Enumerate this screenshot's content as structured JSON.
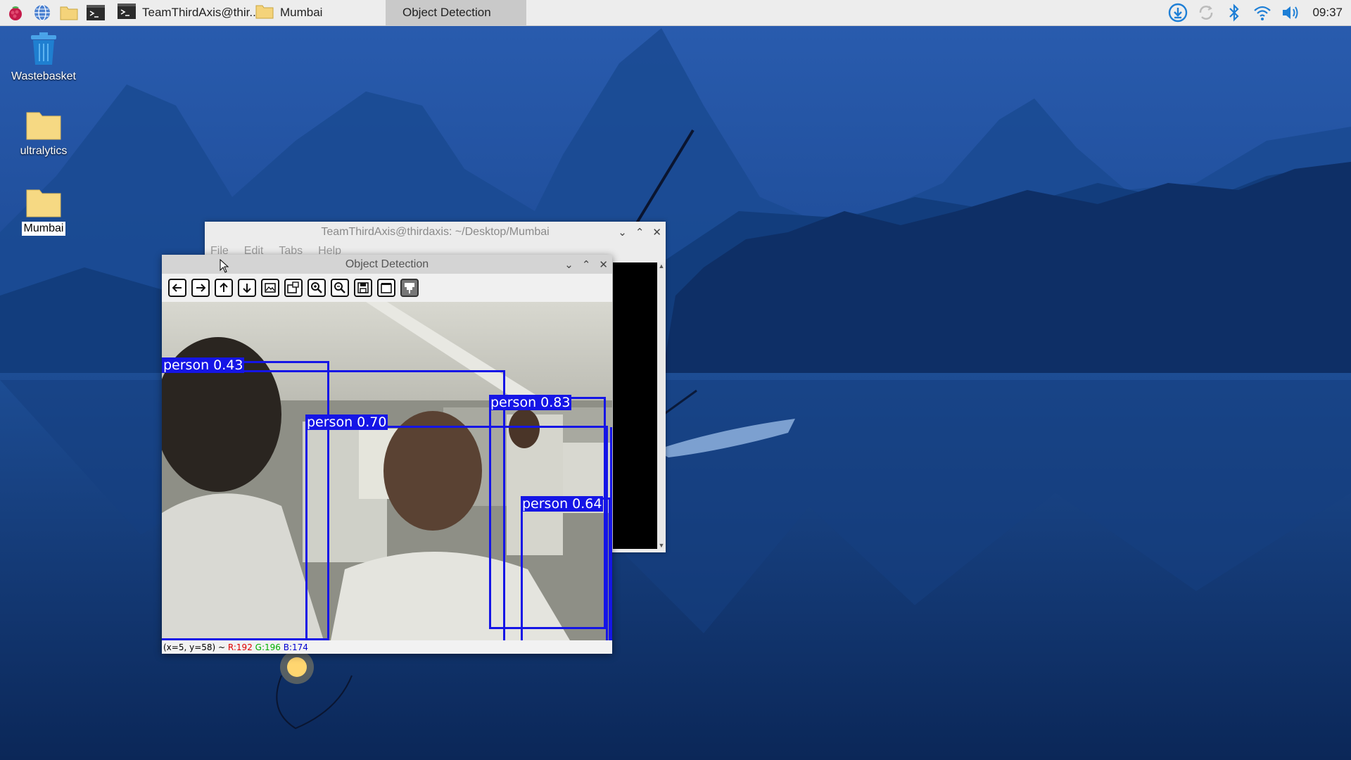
{
  "taskbar": {
    "tasks": [
      {
        "label": "TeamThirdAxis@thir..",
        "icon": "terminal-icon"
      },
      {
        "label": "Mumbai",
        "icon": "folder-icon"
      },
      {
        "label": "Object Detection",
        "icon": "",
        "active": true
      }
    ],
    "tray": [
      "download-icon",
      "sync-icon",
      "bluetooth-icon",
      "wifi-icon",
      "volume-icon"
    ],
    "clock": "09:37"
  },
  "desktop": {
    "icons": [
      {
        "label": "Wastebasket",
        "icon": "trash-icon"
      },
      {
        "label": "ultralytics",
        "icon": "folder-icon"
      },
      {
        "label": "Mumbai",
        "icon": "folder-icon",
        "selected": true
      }
    ]
  },
  "terminal": {
    "title": "TeamThirdAxis@thirdaxis: ~/Desktop/Mumbai",
    "menu": [
      "File",
      "Edit",
      "Tabs",
      "Help"
    ]
  },
  "object_detection": {
    "title": "Object Detection",
    "toolbar": [
      "arrow-left-icon",
      "arrow-right-icon",
      "arrow-up-icon",
      "arrow-down-icon",
      "image-icon",
      "image-properties-icon",
      "zoom-in-icon",
      "zoom-out-icon",
      "save-icon",
      "copy-icon",
      "properties-icon"
    ],
    "detections": [
      {
        "label": "person 0.43"
      },
      {
        "label": "person 0.70"
      },
      {
        "label": "person 0.83"
      },
      {
        "label": "person 0.64"
      }
    ],
    "status": {
      "coords": "(x=5, y=58) ~",
      "r": "R:192",
      "g": "G:196",
      "b": "B:174"
    }
  },
  "colors": {
    "detection_box": "#1515e6",
    "taskbar_bg": "#ededed",
    "status_r": "#e00000",
    "status_g": "#00b000",
    "status_b": "#0000d0"
  }
}
